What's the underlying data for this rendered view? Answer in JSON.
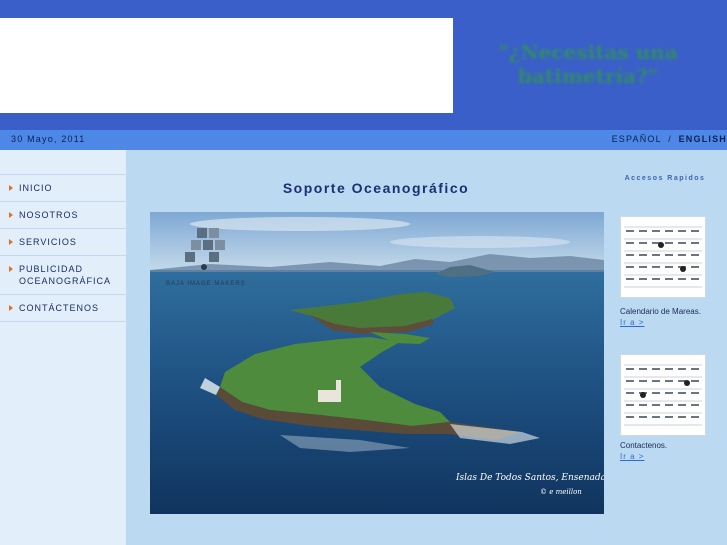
{
  "header": {
    "slogan": "\"¿Necesitas una batimetría?\""
  },
  "datebar": {
    "date": "30 Mayo, 2011",
    "lang_es": "ESPAÑOL",
    "lang_sep": "/",
    "lang_en": "ENGLISH"
  },
  "nav": {
    "items": [
      {
        "label": "INICIO"
      },
      {
        "label": "NOSOTROS"
      },
      {
        "label": "SERVICIOS"
      },
      {
        "label": "PUBLICIDAD OCEANOGRÁFICA"
      },
      {
        "label": "CONTÁCTENOS"
      }
    ]
  },
  "main": {
    "title": "Soporte Oceanográfico",
    "photo": {
      "logo_text": "BAJA IMAGE MAKERS",
      "caption": "Islas De Todos Santos, Ensenada",
      "credit": "© e meillon"
    }
  },
  "quick_access": {
    "title": "Accesos Rapidos",
    "items": [
      {
        "caption": "Calendario de Mareas.",
        "link": "Ir a >"
      },
      {
        "caption": "Contactenos.",
        "link": "Ir a >"
      }
    ]
  },
  "colors": {
    "header": "#3a5fc8",
    "datebar": "#4d88e6",
    "page_bg": "#bcd9f2",
    "sidebar_bg": "#e2eefa",
    "accent_arrow": "#e0701c",
    "title": "#1c2f73"
  }
}
